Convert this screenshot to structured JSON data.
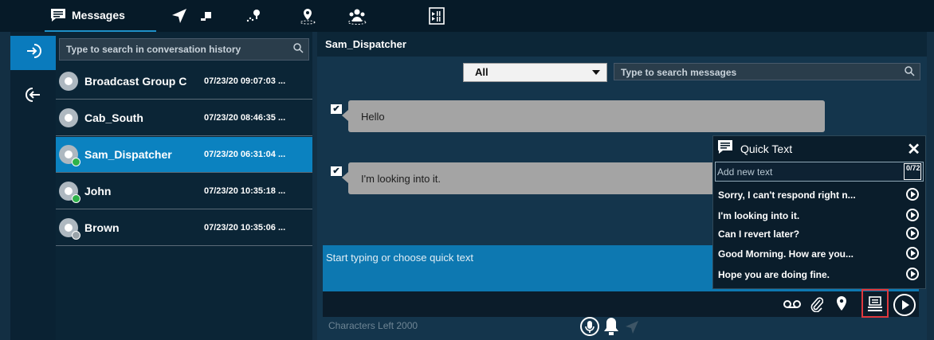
{
  "tabs": [
    {
      "label": "Messages",
      "icon": "message-icon"
    },
    {
      "label": "",
      "icon": "location-arrow-icon"
    },
    {
      "label": "",
      "icon": "map-pins-icon"
    },
    {
      "label": "",
      "icon": "geofence-icon"
    },
    {
      "label": "",
      "icon": "users-group-icon"
    },
    {
      "label": "",
      "icon": "media-player-icon"
    }
  ],
  "rail": [
    {
      "icon": "login-icon",
      "active": true
    },
    {
      "icon": "logout-icon",
      "active": false
    }
  ],
  "conversation_search": {
    "placeholder": "Type to search in conversation history"
  },
  "conversations": [
    {
      "name": "Broadcast Group C",
      "time": "07/23/20 09:07:03 ...",
      "type": "group"
    },
    {
      "name": "Cab_South",
      "time": "07/23/20 08:46:35 ...",
      "type": "group"
    },
    {
      "name": "Sam_Dispatcher",
      "time": "07/23/20 06:31:04 ...",
      "type": "user-online",
      "selected": true
    },
    {
      "name": "John",
      "time": "07/23/20 10:35:18 ...",
      "type": "user-online"
    },
    {
      "name": "Brown",
      "time": "07/23/20 10:35:06 ...",
      "type": "user-offline"
    }
  ],
  "pane": {
    "title": "Sam_Dispatcher",
    "filter": "All",
    "search_placeholder": "Type to search messages",
    "messages": [
      {
        "text": "Hello",
        "checked": true
      },
      {
        "text": "I'm looking into it.",
        "checked": true
      }
    ],
    "compose_placeholder": "Start typing or choose quick text",
    "chars_left": "Characters Left 2000"
  },
  "quick_text": {
    "title": "Quick Text",
    "input_placeholder": "Add new text",
    "counter_top": "0",
    "counter_bottom": "72",
    "items": [
      "Sorry, I can't respond right n...",
      "I'm looking into it.",
      "Can I revert later?",
      "Good Morning. How are you...",
      "Hope you are doing fine."
    ]
  },
  "colors": {
    "accent": "#0b82c0",
    "highlight": "#e0383e",
    "online": "#2fb24a",
    "offline": "#9aa3a9"
  }
}
